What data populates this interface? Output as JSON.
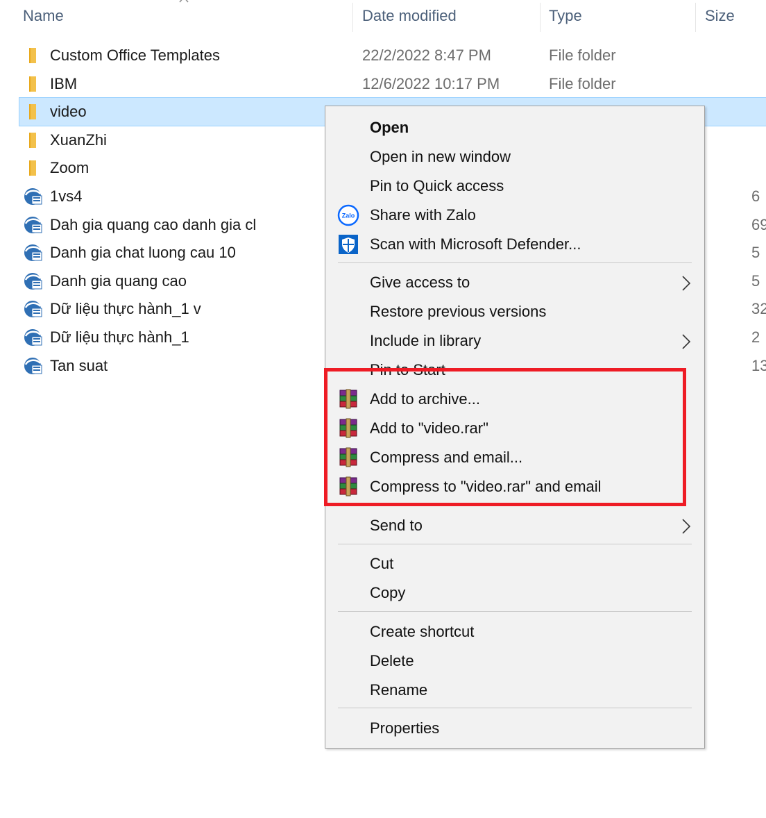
{
  "columns": {
    "name": "Name",
    "date_modified": "Date modified",
    "type": "Type",
    "size": "Size"
  },
  "files": [
    {
      "name": "Custom Office Templates",
      "date": "22/2/2022 8:47 PM",
      "type": "File folder",
      "size": "",
      "icon": "folder-icon"
    },
    {
      "name": "IBM",
      "date": "12/6/2022 10:17 PM",
      "type": "File folder",
      "size": "",
      "icon": "folder-icon"
    },
    {
      "name": "video",
      "date": "",
      "type": "",
      "size": "",
      "icon": "folder-icon",
      "selected": true
    },
    {
      "name": "XuanZhi",
      "date": "",
      "type": "",
      "size": "",
      "icon": "folder-icon"
    },
    {
      "name": "Zoom",
      "date": "",
      "type": "",
      "size": "",
      "icon": "folder-icon"
    },
    {
      "name": "1vs4",
      "date": "",
      "type": "",
      "size": "6",
      "icon": "spss-file-icon"
    },
    {
      "name": "Dah gia quang cao danh gia cl",
      "date": "",
      "type": "",
      "size": "69",
      "icon": "spss-file-icon"
    },
    {
      "name": "Danh gia chat luong cau 10",
      "date": "",
      "type": "",
      "size": "5",
      "icon": "spss-file-icon"
    },
    {
      "name": "Danh gia quang cao",
      "date": "",
      "type": "",
      "size": "5",
      "icon": "spss-file-icon"
    },
    {
      "name": "Dữ liệu thực hành_1 v",
      "date": "",
      "type": "",
      "size": "32",
      "icon": "spss-file-icon"
    },
    {
      "name": "Dữ liệu thực hành_1",
      "date": "",
      "type": "",
      "size": "2",
      "icon": "spss-file-icon"
    },
    {
      "name": "Tan suat",
      "date": "",
      "type": "",
      "size": "13",
      "icon": "spss-file-icon"
    }
  ],
  "menu": {
    "open": "Open",
    "open_new_window": "Open in new window",
    "pin_quick_access": "Pin to Quick access",
    "share_zalo": "Share with Zalo",
    "scan_defender": "Scan with Microsoft Defender...",
    "give_access": "Give access to",
    "restore_versions": "Restore previous versions",
    "include_library": "Include in library",
    "pin_start": "Pin to Start",
    "add_archive": "Add to archive...",
    "add_video_rar": "Add to \"video.rar\"",
    "compress_email": "Compress and email...",
    "compress_video_rar_email": "Compress to \"video.rar\" and email",
    "send_to": "Send to",
    "cut": "Cut",
    "copy": "Copy",
    "create_shortcut": "Create shortcut",
    "delete": "Delete",
    "rename": "Rename",
    "properties": "Properties"
  },
  "icons": {
    "zalo_text": "Zalo"
  },
  "colors": {
    "selection": "#cce8ff",
    "highlight_box": "#ee1c25",
    "folder": "#f3c14b",
    "defender": "#0a64c8"
  }
}
